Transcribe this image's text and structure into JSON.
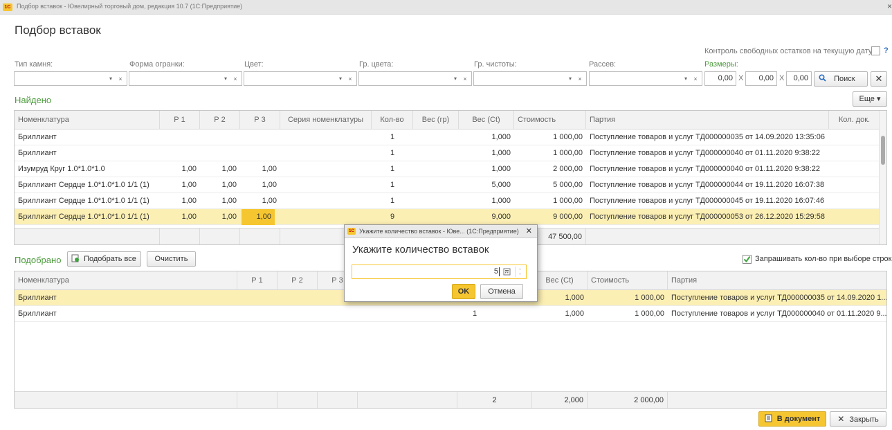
{
  "window": {
    "title": "Подбор вставок - Ювелирный торговый дом, редакция 10.7  (1С:Предприятие)",
    "logo": "1С",
    "close_glyph": "×"
  },
  "form_title": "Подбор вставок",
  "control_text": "Контроль свободных остатков на текущую дату:",
  "control_help": "?",
  "filters": {
    "stone_type": "Тип камня:",
    "cut_form": "Форма огранки:",
    "color": "Цвет:",
    "color_group": "Гр. цвета:",
    "purity_group": "Гр. чистоты:",
    "sieve": "Рассев:",
    "sizes": "Размеры:",
    "size1": "0,00",
    "size2": "0,00",
    "size3": "0,00",
    "x_sep": "X",
    "search_label": "Поиск",
    "clear_glyph": "✕",
    "dd_glyph": "▾",
    "clr_glyph": "×"
  },
  "found": {
    "title": "Найдено",
    "more_button": "Еще ▾",
    "columns": [
      "Номенклатура",
      "Р 1",
      "Р 2",
      "Р 3",
      "Серия номенклатуры",
      "Кол-во",
      "Вес (гр)",
      "Вес (Ct)",
      "Стоимость",
      "Партия",
      "Кол. док."
    ],
    "rows": [
      [
        "Бриллиант",
        "",
        "",
        "",
        "",
        "1",
        "",
        "1,000",
        "1 000,00",
        "Поступление товаров и услуг ТД000000035 от 14.09.2020 13:35:06",
        ""
      ],
      [
        "Бриллиант",
        "",
        "",
        "",
        "",
        "1",
        "",
        "1,000",
        "1 000,00",
        "Поступление товаров и услуг ТД000000040 от 01.11.2020 9:38:22",
        ""
      ],
      [
        "Изумруд Круг 1.0*1.0*1.0",
        "1,00",
        "1,00",
        "1,00",
        "",
        "1",
        "",
        "1,000",
        "2 000,00",
        "Поступление товаров и услуг ТД000000040 от 01.11.2020 9:38:22",
        ""
      ],
      [
        "Бриллиант Сердце 1.0*1.0*1.0 1/1 (1)",
        "1,00",
        "1,00",
        "1,00",
        "",
        "1",
        "",
        "5,000",
        "5 000,00",
        "Поступление товаров и услуг ТД000000044 от 19.11.2020 16:07:38",
        ""
      ],
      [
        "Бриллиант Сердце 1.0*1.0*1.0 1/1 (1)",
        "1,00",
        "1,00",
        "1,00",
        "",
        "1",
        "",
        "1,000",
        "1 000,00",
        "Поступление товаров и услуг ТД000000045 от 19.11.2020 16:07:46",
        ""
      ],
      [
        "Бриллиант Сердце 1.0*1.0*1.0 1/1 (1)",
        "1,00",
        "1,00",
        "1,00",
        "",
        "9",
        "",
        "9,000",
        "9 000,00",
        "Поступление товаров и услуг ТД000000053 от 26.12.2020 15:29:58",
        ""
      ]
    ],
    "total_cost": "47 500,00"
  },
  "picked": {
    "title": "Подобрано",
    "pick_all": "Подобрать все",
    "clear": "Очистить",
    "ask_qty": "Запрашивать кол-во при выборе строки",
    "columns": [
      "Номенклатура",
      "Р 1",
      "Р 2",
      "Р 3",
      "Вес (Ct)",
      "Стоимость",
      "Партия"
    ],
    "rows": [
      {
        "name": "Бриллиант",
        "qty": "",
        "ct": "1,000",
        "cost": "1 000,00",
        "batch": "Поступление товаров и услуг ТД000000035 от 14.09.2020 1..."
      },
      {
        "name": "Бриллиант",
        "qty": "1",
        "ct": "1,000",
        "cost": "1 000,00",
        "batch": "Поступление товаров и услуг ТД000000040 от 01.11.2020 9..."
      }
    ],
    "totals": {
      "qty": "2",
      "ct": "2,000",
      "cost": "2 000,00"
    }
  },
  "dialog": {
    "title": "Укажите количество вставок - Юве...  (1С:Предприятие)",
    "heading": "Укажите количество вставок",
    "value": "5",
    "ok": "OK",
    "cancel": "Отмена",
    "close_glyph": "✕"
  },
  "bottom": {
    "to_document": "В документ",
    "close": "Закрыть",
    "close_glyph": "✕"
  }
}
